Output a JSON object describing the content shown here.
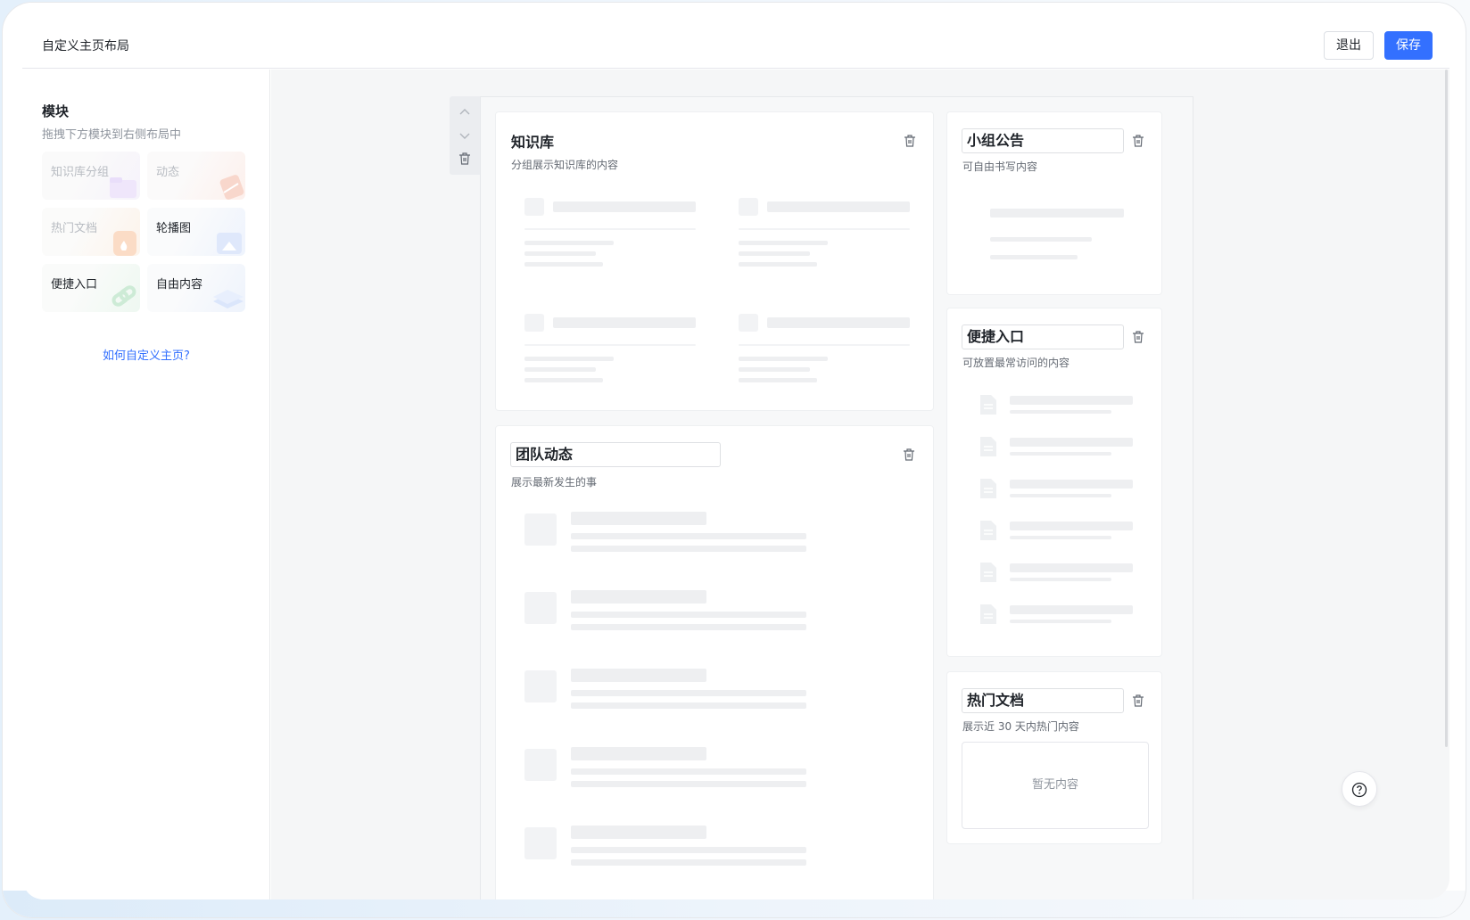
{
  "header": {
    "title": "自定义主页布局",
    "exit_label": "退出",
    "save_label": "保存"
  },
  "sidebar": {
    "title": "模块",
    "subtitle": "拖拽下方模块到右侧布局中",
    "modules": [
      {
        "label": "知识库分组",
        "enabled": false
      },
      {
        "label": "动态",
        "enabled": false
      },
      {
        "label": "热门文档",
        "enabled": false
      },
      {
        "label": "轮播图",
        "enabled": true
      },
      {
        "label": "便捷入口",
        "enabled": true
      },
      {
        "label": "自由内容",
        "enabled": true
      }
    ],
    "help_link": "如何自定义主页?"
  },
  "layout": {
    "knowledge": {
      "title": "知识库",
      "desc": "分组展示知识库的内容"
    },
    "team": {
      "title": "团队动态",
      "desc": "展示最新发生的事"
    },
    "notice": {
      "title": "小组公告",
      "desc": "可自由书写内容"
    },
    "shortcut": {
      "title": "便捷入口",
      "desc": "可放置最常访问的内容"
    },
    "hotdocs": {
      "title": "热门文档",
      "desc": "展示近 30 天内热门内容",
      "empty": "暂无内容"
    }
  },
  "colors": {
    "accent": "#3370ff",
    "canvas_bg": "#f5f6f7"
  }
}
